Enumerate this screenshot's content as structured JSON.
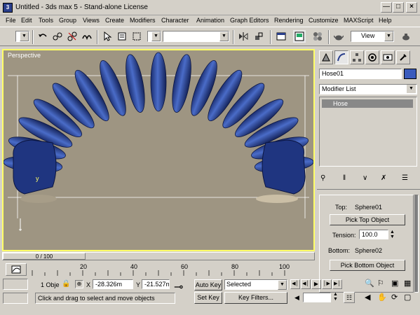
{
  "window": {
    "title": "Untitled - 3ds max 5 - Stand-alone License",
    "app_icon_glyph": "3"
  },
  "menu": [
    "File",
    "Edit",
    "Tools",
    "Group",
    "Views",
    "Create",
    "Modifiers",
    "Character",
    "Animation",
    "Graph Editors",
    "Rendering",
    "Customize",
    "MAXScript",
    "Help"
  ],
  "toolbar": {
    "view_combo": "View"
  },
  "viewport": {
    "label": "Perspective",
    "axis_label": "y"
  },
  "command_panel": {
    "object_name": "Hose01",
    "modifier_list": "Modifier List",
    "stack_item": "Hose",
    "params": {
      "top_label": "Top:",
      "top_value": "Sphere01",
      "pick_top": "Pick Top Object",
      "tension_label": "Tension:",
      "tension_value": "100.0",
      "bottom_label": "Bottom:",
      "bottom_value": "Sphere02",
      "pick_bottom": "Pick Bottom Object"
    }
  },
  "timeline": {
    "frame_counter": "0 / 100",
    "ticks": [
      "20",
      "40",
      "60",
      "80",
      "100"
    ]
  },
  "status": {
    "selection_count": "1 Obje",
    "x_label": "X",
    "x_value": "-28.326m",
    "y_label": "Y",
    "y_value": "-21.527m",
    "prompt": "Click and drag to select and move objects",
    "auto_key": "Auto Key",
    "set_key": "Set Key",
    "selected_combo": "Selected",
    "key_filters": "Key Filters..."
  }
}
